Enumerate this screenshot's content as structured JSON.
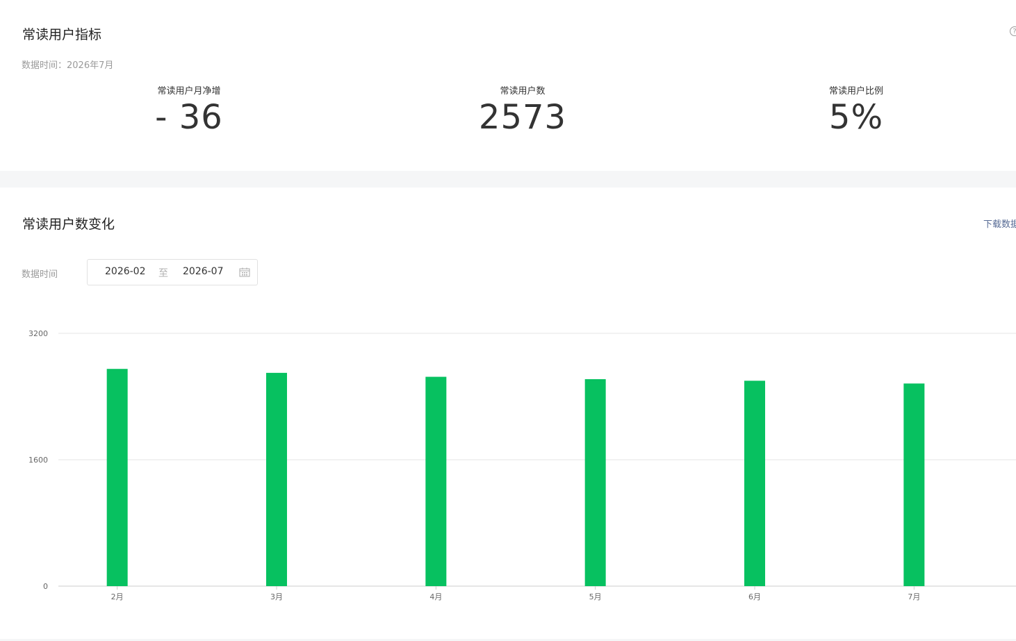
{
  "metrics_section": {
    "title": "常读用户指标",
    "data_time": "数据时间：2026年7月",
    "help_icon": "question-circle-icon",
    "kpis": [
      {
        "label": "常读用户月净增",
        "value": "- 36"
      },
      {
        "label": "常读用户数",
        "value": "2573"
      },
      {
        "label": "常读用户比例",
        "value": "5%"
      }
    ]
  },
  "trend_section": {
    "title": "常读用户数变化",
    "download_label": "下载数据",
    "filter_label": "数据时间",
    "date_start": "2026-02",
    "date_separator": "至",
    "date_end": "2026-07",
    "calendar_icon": "calendar-icon"
  },
  "colors": {
    "bar": "#07c160",
    "link": "#576b95",
    "grid": "#e5e5e5",
    "page_gap": "#f5f6f7"
  },
  "chart_data": {
    "type": "bar",
    "categories": [
      "2月",
      "3月",
      "4月",
      "5月",
      "6月",
      "7月"
    ],
    "values": [
      2750,
      2700,
      2650,
      2620,
      2600,
      2565
    ],
    "y_ticks": [
      "0",
      "1600",
      "3200"
    ],
    "ylim": [
      0,
      3200
    ],
    "grid": true,
    "legend": "none",
    "title": "",
    "xlabel": "",
    "ylabel": ""
  }
}
